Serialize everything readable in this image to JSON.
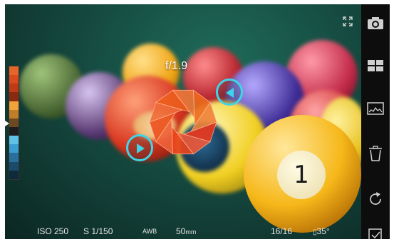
{
  "overlay": {
    "aperture": "f/1.9"
  },
  "ball_number": "1",
  "status_bar": {
    "iso": "ISO 250",
    "shutter": "S  1/150",
    "white_balance": "AWB",
    "focal_value": "50",
    "focal_unit": "mm",
    "frame_count": "16/16",
    "temperature": "35°"
  },
  "exposure_scale_colors": [
    "#e6652a",
    "#d94a1e",
    "#c03a17",
    "#8a2a10",
    "#f2a23a",
    "#c07e2a",
    "#6b4a22",
    "#1d1d1d",
    "#5fc1e6",
    "#3a9ed0",
    "#2a6f9c",
    "#1a4b6a",
    "#0e2a3c"
  ],
  "accent_color": "#3dd6e8",
  "toolbar": {
    "items": [
      {
        "icon": "camera-icon"
      },
      {
        "icon": "grid-icon"
      },
      {
        "icon": "histogram-icon"
      },
      {
        "icon": "trash-icon"
      },
      {
        "icon": "rotate-icon"
      },
      {
        "icon": "checkbox-icon"
      }
    ]
  }
}
